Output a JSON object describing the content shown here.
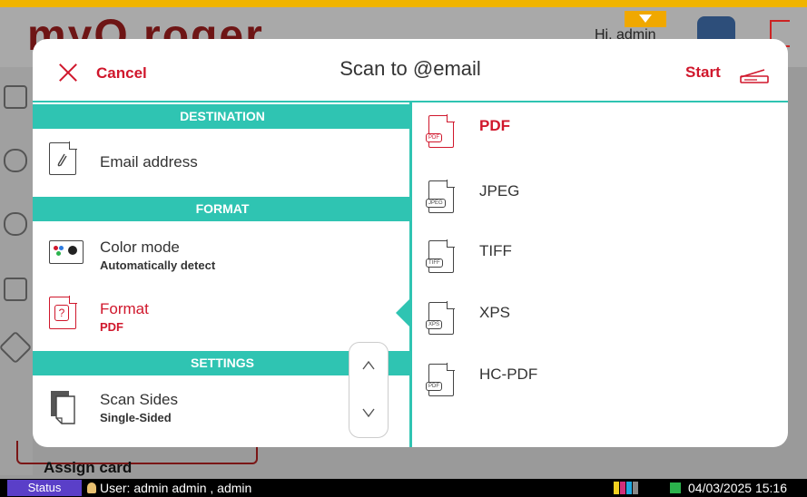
{
  "app": {
    "logo": "myQ roger",
    "greeting": "Hi, admin",
    "bottom_card": "Assign card"
  },
  "dialog": {
    "cancel_label": "Cancel",
    "title": "Scan to @email",
    "start_label": "Start"
  },
  "left_panel": {
    "destination_header": "DESTINATION",
    "format_header": "FORMAT",
    "settings_header": "SETTINGS",
    "email": {
      "label": "Email address"
    },
    "color_mode": {
      "label": "Color mode",
      "value": "Automatically detect"
    },
    "format": {
      "label": "Format",
      "value": "PDF"
    },
    "scan_sides": {
      "label": "Scan Sides",
      "value": "Single-Sided"
    }
  },
  "formats": [
    {
      "label": "PDF",
      "tag": "PDF",
      "selected": true
    },
    {
      "label": "JPEG",
      "tag": "JPEG",
      "selected": false
    },
    {
      "label": "TIFF",
      "tag": "TIFF",
      "selected": false
    },
    {
      "label": "XPS",
      "tag": "XPS",
      "selected": false
    },
    {
      "label": "HC-PDF",
      "tag": "PDF",
      "selected": false
    }
  ],
  "status_bar": {
    "status_label": "Status",
    "user": "User: admin admin , admin",
    "datetime": "04/03/2025 15:16"
  },
  "colors": {
    "accent": "#2fc4b2",
    "highlight": "#d0172c"
  }
}
